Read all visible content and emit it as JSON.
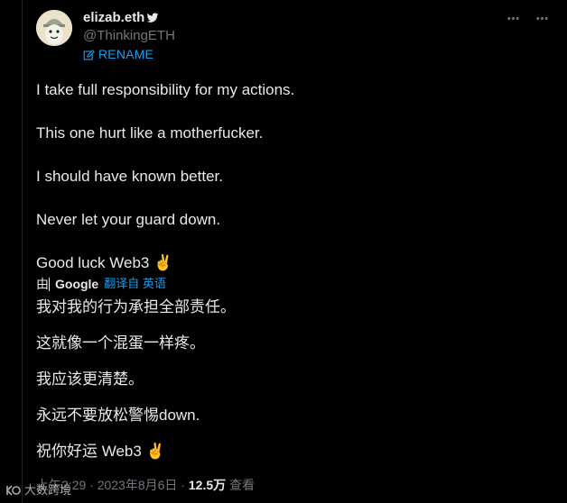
{
  "author": {
    "display_name": "elizab.eth",
    "handle": "@ThinkingETH",
    "rename_label": "RENAME"
  },
  "tweet": {
    "lines": [
      "I take full responsibility for my actions.",
      "This one hurt like a motherfucker.",
      "I should have known better.",
      "Never let your guard down.",
      "Good luck Web3 ✌️"
    ]
  },
  "translation": {
    "by_label": "由",
    "provider": "Google",
    "link_label": "翻译自 英语",
    "lines": [
      "我对我的行为承担全部责任。",
      "这就像一个混蛋一样疼。",
      "我应该更清楚。",
      "永远不要放松警惕down.",
      "祝你好运 Web3 ✌️"
    ]
  },
  "meta": {
    "time": "上午2:29",
    "sep1": " · ",
    "date": "2023年8月6日",
    "sep2": " · ",
    "views_count": "12.5万",
    "views_label": " 查看"
  },
  "watermark": {
    "text": "大数跨境"
  },
  "icons": {
    "verified": "bird-icon",
    "rename": "edit-icon",
    "grok": "grok-icon",
    "more": "more-icon"
  },
  "colors": {
    "background": "#000000",
    "text": "#e7e9ea",
    "muted": "#71767b",
    "accent": "#1d9bf0"
  }
}
